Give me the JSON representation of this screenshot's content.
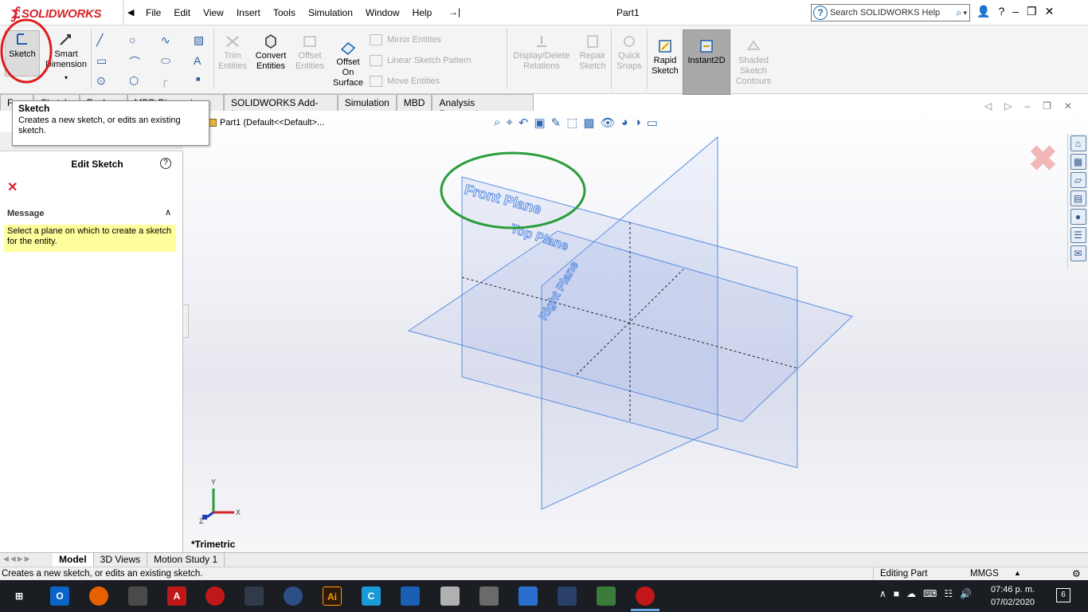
{
  "app": {
    "logo_text": "SOLIDWORKS",
    "document_title": "Part1",
    "brand_color": "#d6232a"
  },
  "menubar": [
    "File",
    "Edit",
    "View",
    "Insert",
    "Tools",
    "Simulation",
    "Window",
    "Help"
  ],
  "help_search": {
    "placeholder": "Search SOLIDWORKS Help"
  },
  "command_manager": {
    "sketch": "Sketch",
    "smart_dimension": "Smart Dimension",
    "trim_entities": "Trim Entities",
    "convert_entities": "Convert Entities",
    "offset_entities": "Offset Entities",
    "offset_on_surface": "Offset On Surface",
    "mirror_entities": "Mirror Entities",
    "linear_sketch_pattern": "Linear Sketch Pattern",
    "move_entities": "Move Entities",
    "display_delete_relations": "Display/Delete Relations",
    "repair_sketch": "Repair Sketch",
    "quick_snaps": "Quick Snaps",
    "rapid_sketch": "Rapid Sketch",
    "instant2d": "Instant2D",
    "shaded_sketch_contours": "Shaded Sketch Contours"
  },
  "tabs": [
    "Fe",
    "Sketch",
    "Evalu",
    "MBD Dimensions",
    "SOLIDWORKS Add-Ins",
    "Simulation",
    "MBD",
    "Analysis Preparation"
  ],
  "tooltip": {
    "title": "Sketch",
    "body": "Creates a new sketch, or edits an existing sketch."
  },
  "property_manager": {
    "title": "Edit Sketch",
    "message_header": "Message",
    "message": "Select a plane on which to create a sketch for the entity."
  },
  "graphics": {
    "tree_label": "Part1  (Default<<Default>...",
    "planes": [
      "Front Plane",
      "Top Plane",
      "Right Plane"
    ],
    "view_orientation": "*Trimetric",
    "triad": {
      "x": "X",
      "y": "Y",
      "z": "Z"
    },
    "plane_color": "#5b8fe0",
    "highlight_circle_color": "#2a9d3a",
    "red_circle_color": "#e01b1b"
  },
  "bottom_tabs": [
    "Model",
    "3D Views",
    "Motion Study 1"
  ],
  "statusbar": {
    "text": "Creates a new sketch, or edits an existing sketch.",
    "mode": "Editing Part",
    "units": "MMGS"
  },
  "taskbar": {
    "time": "07:46 p. m.",
    "date": "07/02/2020",
    "notification_count": "6"
  }
}
